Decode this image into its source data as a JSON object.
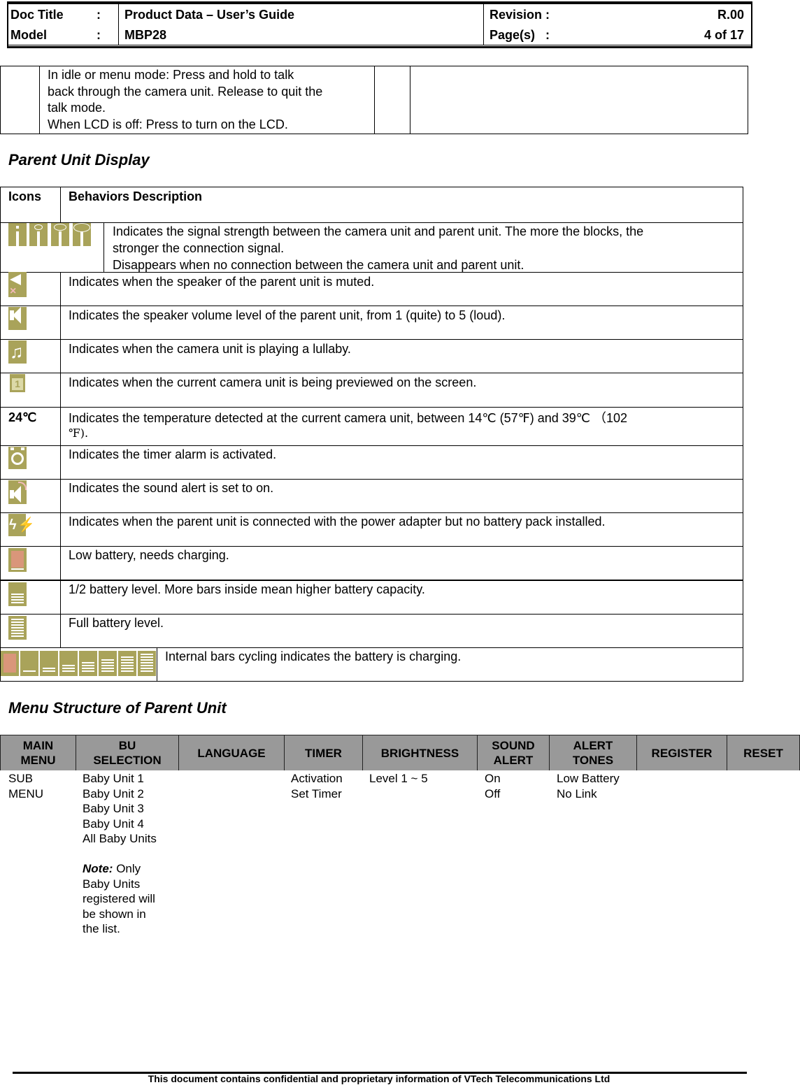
{
  "header": {
    "doc_title_label": "Doc Title",
    "model_label": "Model",
    "colon": ":",
    "doc_title": "Product Data – User’s Guide",
    "model": "MBP28",
    "revision_label": "Revision :",
    "revision": "R.00",
    "pages_label": "Page(s)   :",
    "pages": "4 of 17"
  },
  "top_table": {
    "lines": [
      "In idle or menu mode: Press and hold to talk",
      "back through the camera unit. Release to quit the",
      "talk mode.",
      "When LCD is off: Press to turn on the LCD."
    ]
  },
  "parent_display": {
    "title": "Parent Unit Display",
    "col_icons": "Icons",
    "col_desc": "Behaviors Description",
    "rows": [
      {
        "icon": "signal-strength-icons",
        "lines": [
          "Indicates the signal strength between the camera unit and parent unit. The more the blocks, the",
          "stronger the connection signal.",
          "Disappears when no connection between the camera unit and parent unit."
        ]
      },
      {
        "icon": "speaker-muted-icon",
        "text": "Indicates when the speaker of the parent unit is muted."
      },
      {
        "icon": "speaker-volume-icon",
        "text": "Indicates the speaker volume level of the parent unit, from 1 (quite) to 5 (loud)."
      },
      {
        "icon": "lullaby-music-icon",
        "text": "Indicates when the camera unit is playing a lullaby."
      },
      {
        "icon": "camera-unit-1-icon",
        "text": "Indicates when the current camera unit is being previewed on the screen."
      },
      {
        "icon_text": "24℃",
        "text": "Indicates the temperature detected at the current camera unit, between 14℃ (57℉) and 39℃ （102",
        "text2": "℉)."
      },
      {
        "icon": "timer-alarm-icon",
        "text": "Indicates the timer alarm is activated."
      },
      {
        "icon": "sound-alert-icon",
        "text": "Indicates the sound alert is set to on."
      },
      {
        "icon": "power-adapter-icon",
        "text": "Indicates when the parent unit is connected with the power adapter but no battery pack installed."
      },
      {
        "icon": "battery-low-icon",
        "text": "Low battery, needs charging."
      },
      {
        "icon": "battery-half-icon",
        "text": "1/2 battery level. More bars inside mean higher battery capacity."
      },
      {
        "icon": "battery-full-icon",
        "text": "Full battery level."
      },
      {
        "icon": "battery-charging-sequence-icon",
        "text": "Internal bars cycling indicates the battery is charging."
      }
    ]
  },
  "menu_structure": {
    "title": "Menu Structure of Parent Unit",
    "headers": [
      [
        "MAIN",
        "MENU"
      ],
      [
        "BU",
        "SELECTION"
      ],
      [
        "LANGUAGE"
      ],
      [
        "TIMER"
      ],
      [
        "BRIGHTNESS"
      ],
      [
        "SOUND",
        "ALERT"
      ],
      [
        "ALERT",
        "TONES"
      ],
      [
        "REGISTER"
      ],
      [
        "RESET"
      ]
    ],
    "sub_label": [
      "SUB",
      "MENU"
    ],
    "bu_selection": [
      "Baby Unit 1",
      "Baby Unit 2",
      "Baby Unit 3",
      "Baby Unit 4",
      "All Baby Units"
    ],
    "note_label": "Note:",
    "note_lines": [
      "Only",
      "Baby Units",
      "registered will",
      "be shown in",
      "the list."
    ],
    "timer": [
      "Activation",
      "Set Timer"
    ],
    "brightness": [
      "Level 1 ~ 5"
    ],
    "sound_alert": [
      "On",
      "Off"
    ],
    "alert_tones": [
      "Low Battery",
      "No Link"
    ]
  },
  "footer": {
    "text": "This document contains confidential and proprietary information of VTech Telecommunications Ltd"
  },
  "colors": {
    "icon_olive": "#a9a35a",
    "battery_low": "#d9967a",
    "menu_header_gray": "#999999"
  }
}
